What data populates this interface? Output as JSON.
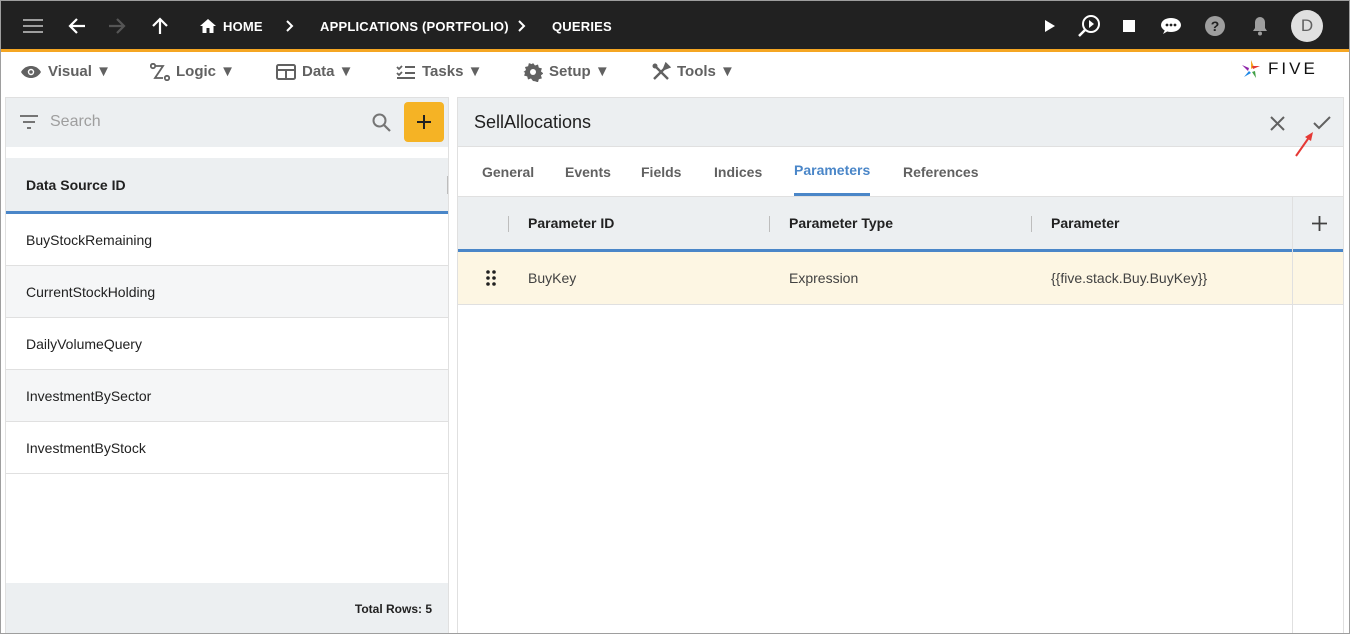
{
  "topbar": {
    "breadcrumbs": [
      "HOME",
      "APPLICATIONS (PORTFOLIO)",
      "QUERIES"
    ],
    "avatar_letter": "D"
  },
  "menu": {
    "items": [
      "Visual ▼",
      "Logic ▼",
      "Data ▼",
      "Tasks ▼",
      "Setup ▼",
      "Tools ▼"
    ]
  },
  "logo": {
    "text": "FIVE"
  },
  "left_panel": {
    "search_placeholder": "Search",
    "column_header": "Data Source ID",
    "items": [
      "BuyStockRemaining",
      "CurrentStockHolding",
      "DailyVolumeQuery",
      "InvestmentBySector",
      "InvestmentByStock"
    ],
    "total_rows": "Total Rows: 5"
  },
  "form": {
    "title": "SellAllocations",
    "tabs": [
      "General",
      "Events",
      "Fields",
      "Indices",
      "Parameters",
      "References"
    ],
    "active_tab": "Parameters",
    "columns": [
      "Parameter ID",
      "Parameter Type",
      "Parameter"
    ],
    "rows": [
      {
        "parameter_id": "BuyKey",
        "parameter_type": "Expression",
        "parameter": "{{five.stack.Buy.BuyKey}}"
      }
    ]
  },
  "colors": {
    "accent": "#4a86c8",
    "brand": "#f5a623",
    "add_button": "#f5b325",
    "row_highlight": "#fdf6e3",
    "topbar": "#212121"
  }
}
